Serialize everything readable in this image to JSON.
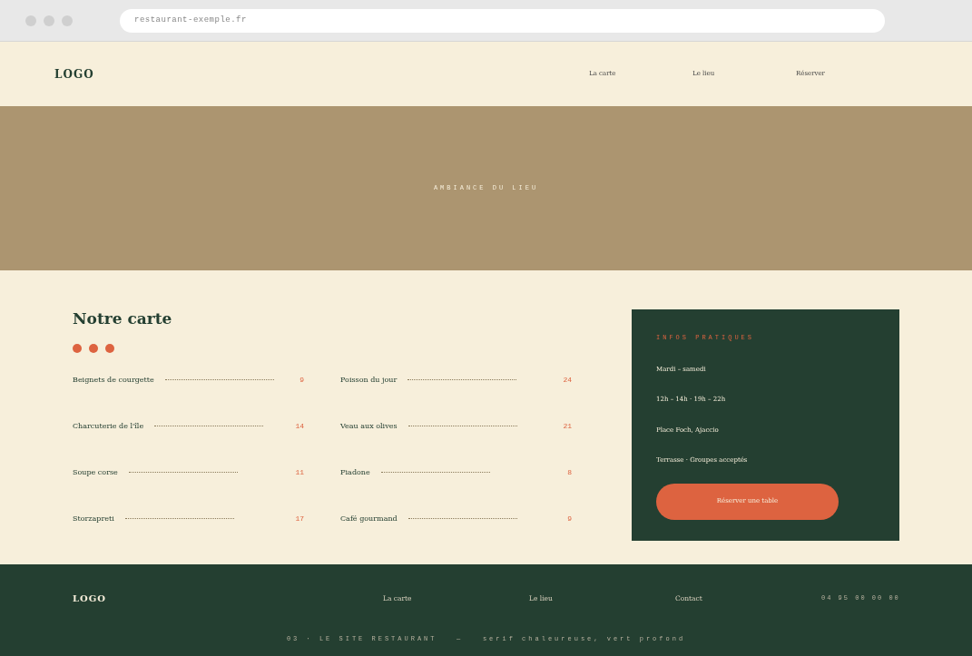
{
  "browser": {
    "address": "restaurant-exemple.fr"
  },
  "header": {
    "logo": "LOGO",
    "nav": [
      "La carte",
      "Le lieu",
      "Réserver"
    ]
  },
  "hero": {
    "caption": "AMBIANCE DU LIEU"
  },
  "menu": {
    "title": "Notre carte",
    "columns": [
      [
        {
          "name": "Beignets de courgette",
          "price": "9"
        },
        {
          "name": "Charcuterie de l'île",
          "price": "14"
        },
        {
          "name": "Soupe corse",
          "price": "11"
        },
        {
          "name": "Storzapreti",
          "price": "17"
        }
      ],
      [
        {
          "name": "Poisson du jour",
          "price": "24"
        },
        {
          "name": "Veau aux olives",
          "price": "21"
        },
        {
          "name": "Fiadone",
          "price": "8"
        },
        {
          "name": "Café gourmand",
          "price": "9"
        }
      ]
    ]
  },
  "infos": {
    "title": "INFOS PRATIQUES",
    "lines": [
      "Mardi – samedi",
      "12h – 14h · 19h – 22h",
      "Place Foch, Ajaccio",
      "Terrasse · Groupes acceptés"
    ],
    "button": "Réserver une table"
  },
  "footer": {
    "logo": "LOGO",
    "links": [
      "La carte",
      "Le lieu",
      "Contact"
    ],
    "phone": "04 95 00 00 00",
    "caption": "03 · LE SITE RESTAURANT   —   serif chaleureuse, vert profond"
  }
}
